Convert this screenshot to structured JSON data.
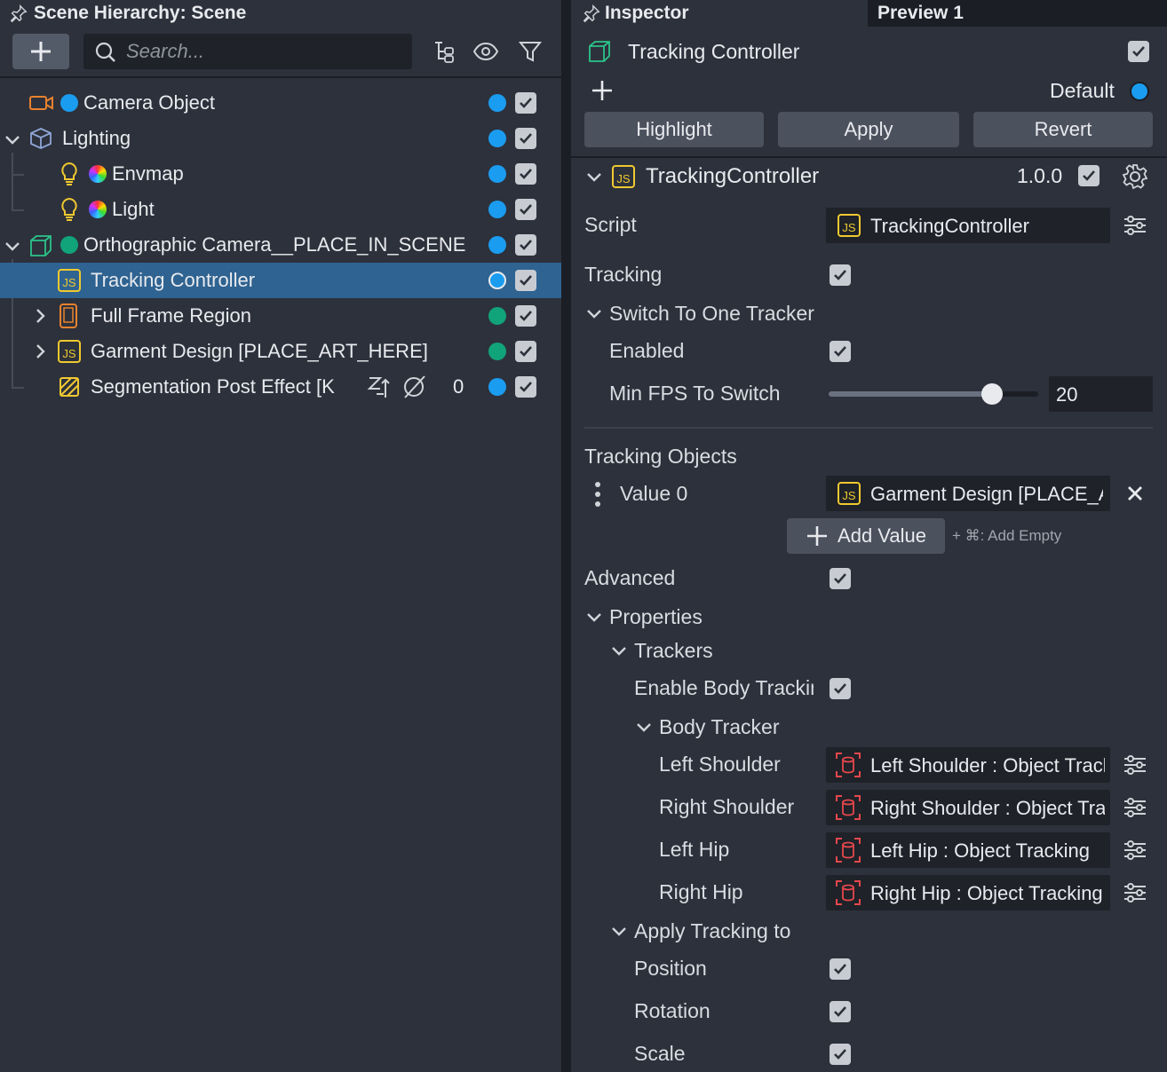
{
  "hierarchy": {
    "title": "Scene Hierarchy: Scene",
    "search_placeholder": "Search...",
    "rows": [
      {
        "label": "Camera Object",
        "dot": "#1a9cf0",
        "vis_dot": "#1a9cf0",
        "checked": true
      },
      {
        "label": "Lighting",
        "dot": "",
        "vis_dot": "#1a9cf0",
        "checked": true
      },
      {
        "label": "Envmap",
        "dot": "rainbow",
        "vis_dot": "#1a9cf0",
        "checked": true
      },
      {
        "label": "Light",
        "dot": "rainbow",
        "vis_dot": "#1a9cf0",
        "checked": true
      },
      {
        "label": "Orthographic Camera__PLACE_IN_SCENE",
        "dot": "#11a37a",
        "vis_dot": "#1a9cf0",
        "checked": true
      },
      {
        "label": "Tracking Controller",
        "dot": "",
        "vis_dot": "#1a9cf0",
        "checked": true,
        "selected": true
      },
      {
        "label": "Full Frame Region",
        "dot": "",
        "vis_dot": "#11a37a",
        "checked": true
      },
      {
        "label": "Garment Design [PLACE_ART_HERE]",
        "dot": "",
        "vis_dot": "#11a37a",
        "checked": true
      },
      {
        "label": "Segmentation Post Effect [K",
        "dot": "",
        "vis_dot": "#1a9cf0",
        "checked": true,
        "count": "0"
      }
    ]
  },
  "inspector": {
    "title": "Inspector",
    "preview_tab": "Preview 1",
    "object_name": "Tracking Controller",
    "layer_label": "Default",
    "buttons": {
      "highlight": "Highlight",
      "apply": "Apply",
      "revert": "Revert"
    },
    "component": {
      "name": "TrackingController",
      "version": "1.0.0"
    },
    "fields": {
      "script_label": "Script",
      "script_value": "TrackingController",
      "tracking_label": "Tracking",
      "switch_section": "Switch To One Tracker",
      "enabled_label": "Enabled",
      "min_fps_label": "Min FPS To Switch",
      "min_fps_value": "20",
      "min_fps_fraction": 0.78,
      "tracking_objects_label": "Tracking Objects",
      "value0_label": "Value 0",
      "value0_value": "Garment Design [PLACE_ART_HERE]",
      "add_value_label": "Add Value",
      "add_empty_hint": "+ ⌘: Add Empty",
      "advanced_label": "Advanced",
      "properties_section": "Properties",
      "trackers_section": "Trackers",
      "enable_body_label": "Enable Body Tracking",
      "body_tracker_section": "Body Tracker",
      "left_shoulder_label": "Left Shoulder",
      "left_shoulder_value": "Left Shoulder : Object Tracking",
      "right_shoulder_label": "Right Shoulder",
      "right_shoulder_value": "Right Shoulder : Object Tracking",
      "left_hip_label": "Left Hip",
      "left_hip_value": "Left Hip : Object Tracking",
      "right_hip_label": "Right Hip",
      "right_hip_value": "Right Hip : Object Tracking",
      "apply_section": "Apply Tracking to",
      "position_label": "Position",
      "rotation_label": "Rotation",
      "scale_label": "Scale"
    }
  }
}
